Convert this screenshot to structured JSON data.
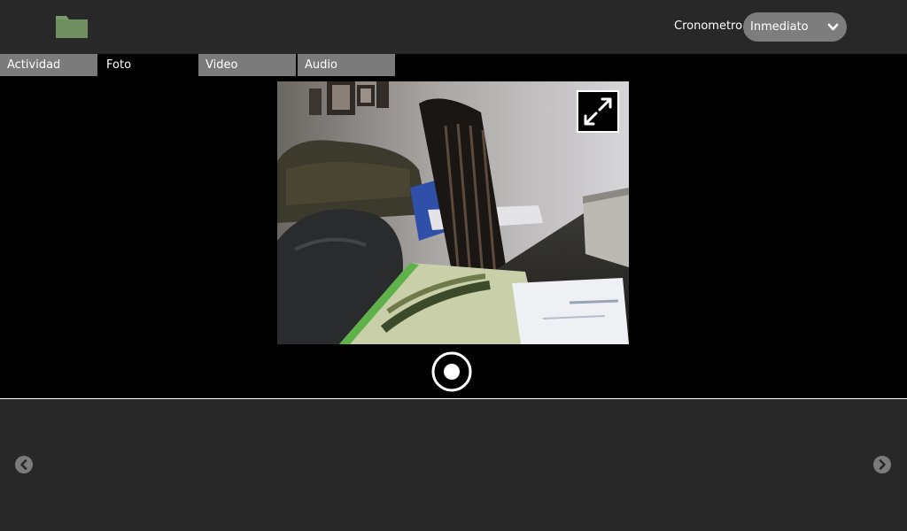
{
  "toolbar": {
    "activity_icon": "folder-icon",
    "timer_label": "Cronometro",
    "timer_value": "Inmediato",
    "timer_arrow_icon": "chevron-down-icon"
  },
  "tabs": [
    {
      "label": "Actividad",
      "active": false
    },
    {
      "label": "Foto",
      "active": true
    },
    {
      "label": "Video",
      "active": false
    },
    {
      "label": "Audio",
      "active": false
    }
  ],
  "viewer": {
    "content": "webcam-preview",
    "fullscreen_icon": "fullscreen-expand-icon",
    "shutter_icon": "record-shutter-icon"
  },
  "tray": {
    "prev_icon": "chevron-left-icon",
    "next_icon": "chevron-right-icon"
  },
  "colors": {
    "toolbar_bg": "#282828",
    "tab_inactive": "#7b7b7b",
    "tab_active": "#000000",
    "combo_bg": "#7d7d7d",
    "folder_green": "#7a9b6a"
  }
}
